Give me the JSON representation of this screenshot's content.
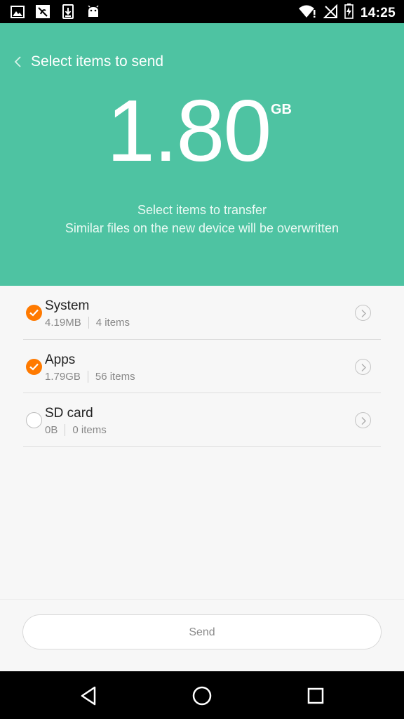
{
  "status_bar": {
    "time": "14:25",
    "left_icons": [
      "image-icon",
      "silent-icon",
      "download-icon",
      "android-icon"
    ],
    "right_icons": [
      "wifi-alert-icon",
      "no-signal-icon",
      "battery-charging-icon"
    ]
  },
  "header": {
    "title": "Select items to send",
    "total_size": "1.80",
    "total_unit": "GB",
    "subtitle_line1": "Select items to transfer",
    "subtitle_line2": "Similar files on the new device will be overwritten",
    "bg_color": "#4ec3a2"
  },
  "items": [
    {
      "title": "System",
      "size": "4.19MB",
      "count": "4 items",
      "checked": true
    },
    {
      "title": "Apps",
      "size": "1.79GB",
      "count": "56 items",
      "checked": true
    },
    {
      "title": "SD card",
      "size": "0B",
      "count": "0 items",
      "checked": false
    }
  ],
  "send_button": {
    "label": "Send"
  },
  "accent_color": "#ff7a00"
}
